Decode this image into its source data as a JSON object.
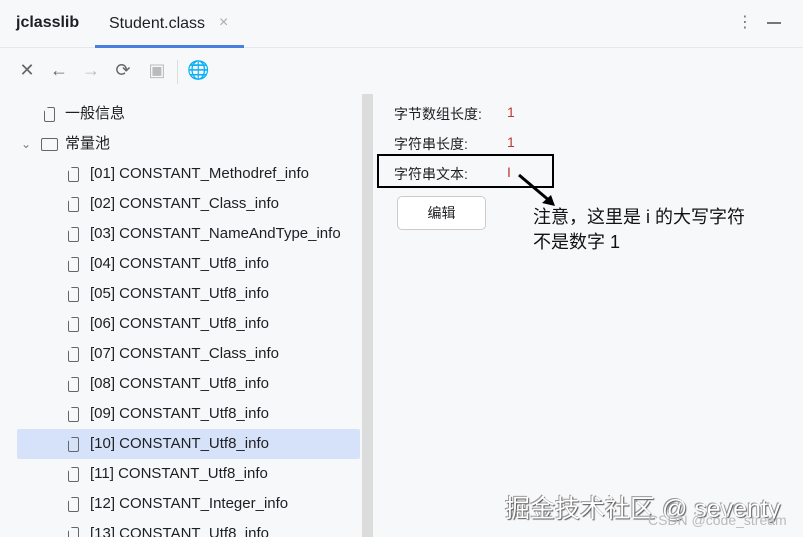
{
  "header": {
    "app_title": "jclasslib",
    "tab_label": "Student.class",
    "tab_close": "×",
    "menu_icon": "⋮"
  },
  "toolbar": {
    "icons": [
      "close-icon",
      "back-icon",
      "forward-icon",
      "refresh-icon",
      "save-icon",
      "web-icon"
    ]
  },
  "tree": {
    "general": "一般信息",
    "pool": "常量池",
    "items": [
      "[01] CONSTANT_Methodref_info",
      "[02] CONSTANT_Class_info",
      "[03] CONSTANT_NameAndType_info",
      "[04] CONSTANT_Utf8_info",
      "[05] CONSTANT_Utf8_info",
      "[06] CONSTANT_Utf8_info",
      "[07] CONSTANT_Class_info",
      "[08] CONSTANT_Utf8_info",
      "[09] CONSTANT_Utf8_info",
      "[10] CONSTANT_Utf8_info",
      "[11] CONSTANT_Utf8_info",
      "[12] CONSTANT_Integer_info",
      "[13] CONSTANT_Utf8_info"
    ],
    "selected_index": 9
  },
  "detail": {
    "byte_len_label": "字节数组长度:",
    "byte_len": "1",
    "str_len_label": "字符串长度:",
    "str_len": "1",
    "str_text_label": "字符串文本:",
    "str_text": "I",
    "edit_button": "编辑"
  },
  "annotation": {
    "line1": "注意，这里是 i 的大写字符",
    "line2": "不是数字 1"
  },
  "watermark": {
    "main": "掘金技术社区 @ seventy",
    "sub": "CSDN @code_stream"
  }
}
